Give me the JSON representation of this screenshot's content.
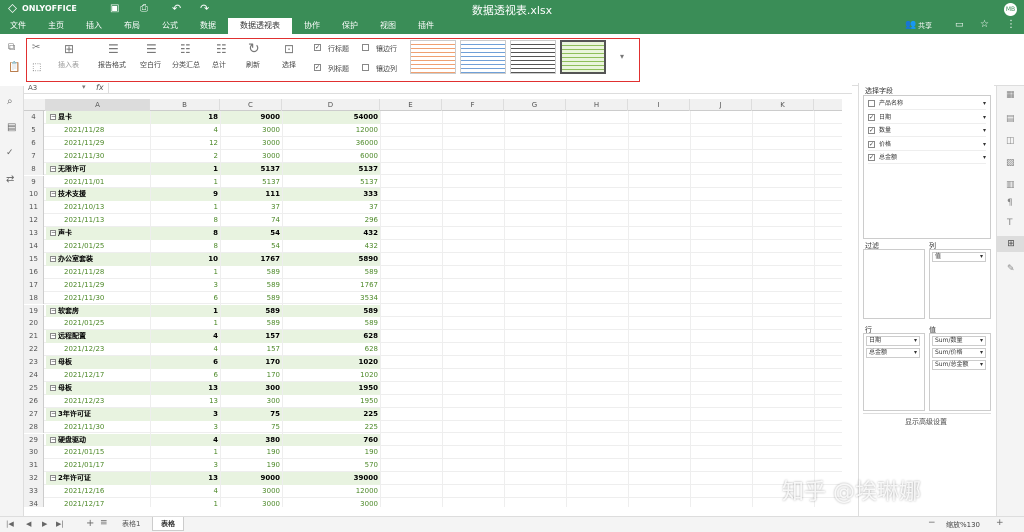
{
  "app": {
    "logo_text": "ONLYOFFICE",
    "title": "数据透视表.xlsx",
    "user_initials": "MB",
    "share_label": "共享"
  },
  "menu": [
    "文件",
    "主页",
    "插入",
    "布局",
    "公式",
    "数据",
    "数据透视表",
    "协作",
    "保护",
    "视图",
    "插件"
  ],
  "toolbar": {
    "insert_table": "插入表",
    "report_layout": "报告格式",
    "blank_rows": "空白行",
    "subtotals": "分类汇总",
    "grand_totals": "总计",
    "refresh": "刷新",
    "select": "选择",
    "row_headers": "行标题",
    "col_headers": "列标题",
    "banded_rows": "镶边行",
    "banded_cols": "镶边列"
  },
  "formula": {
    "cell_ref": "A3",
    "fx": "fx"
  },
  "columns": [
    "A",
    "B",
    "C",
    "D",
    "E",
    "F",
    "G",
    "H",
    "I",
    "J",
    "K",
    "L"
  ],
  "rows": [
    {
      "n": "4",
      "kind": "grp",
      "a": "显卡",
      "b": "18",
      "c": "9000",
      "d": "54000"
    },
    {
      "n": "5",
      "kind": "det",
      "a": "2021/11/28",
      "b": "4",
      "c": "3000",
      "d": "12000"
    },
    {
      "n": "6",
      "kind": "det",
      "a": "2021/11/29",
      "b": "12",
      "c": "3000",
      "d": "36000"
    },
    {
      "n": "7",
      "kind": "det",
      "a": "2021/11/30",
      "b": "2",
      "c": "3000",
      "d": "6000"
    },
    {
      "n": "8",
      "kind": "grp",
      "a": "无限许可",
      "b": "1",
      "c": "5137",
      "d": "5137"
    },
    {
      "n": "9",
      "kind": "det",
      "a": "2021/11/01",
      "b": "1",
      "c": "5137",
      "d": "5137"
    },
    {
      "n": "10",
      "kind": "grp",
      "a": "技术支援",
      "b": "9",
      "c": "111",
      "d": "333"
    },
    {
      "n": "11",
      "kind": "det",
      "a": "2021/10/13",
      "b": "1",
      "c": "37",
      "d": "37"
    },
    {
      "n": "12",
      "kind": "det",
      "a": "2021/11/13",
      "b": "8",
      "c": "74",
      "d": "296"
    },
    {
      "n": "13",
      "kind": "grp",
      "a": "声卡",
      "b": "8",
      "c": "54",
      "d": "432"
    },
    {
      "n": "14",
      "kind": "det",
      "a": "2021/01/25",
      "b": "8",
      "c": "54",
      "d": "432"
    },
    {
      "n": "15",
      "kind": "grp",
      "a": "办公室套装",
      "b": "10",
      "c": "1767",
      "d": "5890"
    },
    {
      "n": "16",
      "kind": "det",
      "a": "2021/11/28",
      "b": "1",
      "c": "589",
      "d": "589"
    },
    {
      "n": "17",
      "kind": "det",
      "a": "2021/11/29",
      "b": "3",
      "c": "589",
      "d": "1767"
    },
    {
      "n": "18",
      "kind": "det",
      "a": "2021/11/30",
      "b": "6",
      "c": "589",
      "d": "3534"
    },
    {
      "n": "19",
      "kind": "grp",
      "a": "软套房",
      "b": "1",
      "c": "589",
      "d": "589"
    },
    {
      "n": "20",
      "kind": "det",
      "a": "2021/01/25",
      "b": "1",
      "c": "589",
      "d": "589"
    },
    {
      "n": "21",
      "kind": "grp",
      "a": "远程配置",
      "b": "4",
      "c": "157",
      "d": "628"
    },
    {
      "n": "22",
      "kind": "det",
      "a": "2021/12/23",
      "b": "4",
      "c": "157",
      "d": "628"
    },
    {
      "n": "23",
      "kind": "grp",
      "a": "母板",
      "b": "6",
      "c": "170",
      "d": "1020"
    },
    {
      "n": "24",
      "kind": "det",
      "a": "2021/12/17",
      "b": "6",
      "c": "170",
      "d": "1020"
    },
    {
      "n": "25",
      "kind": "grp",
      "a": "母板",
      "b": "13",
      "c": "300",
      "d": "1950"
    },
    {
      "n": "26",
      "kind": "det",
      "a": "2021/12/23",
      "b": "13",
      "c": "300",
      "d": "1950"
    },
    {
      "n": "27",
      "kind": "grp",
      "a": "3年许可证",
      "b": "3",
      "c": "75",
      "d": "225"
    },
    {
      "n": "28",
      "kind": "det",
      "a": "2021/11/30",
      "b": "3",
      "c": "75",
      "d": "225"
    },
    {
      "n": "29",
      "kind": "grp",
      "a": "硬盘驱动",
      "b": "4",
      "c": "380",
      "d": "760"
    },
    {
      "n": "30",
      "kind": "det",
      "a": "2021/01/15",
      "b": "1",
      "c": "190",
      "d": "190"
    },
    {
      "n": "31",
      "kind": "det",
      "a": "2021/01/17",
      "b": "3",
      "c": "190",
      "d": "570"
    },
    {
      "n": "32",
      "kind": "grp",
      "a": "2年许可证",
      "b": "13",
      "c": "9000",
      "d": "39000"
    },
    {
      "n": "33",
      "kind": "det",
      "a": "2021/12/16",
      "b": "4",
      "c": "3000",
      "d": "12000"
    },
    {
      "n": "34",
      "kind": "det",
      "a": "2021/12/17",
      "b": "1",
      "c": "3000",
      "d": "3000"
    }
  ],
  "panel": {
    "choose_fields": "选择字段",
    "fields": [
      {
        "label": "产品名称",
        "checked": false
      },
      {
        "label": "日期",
        "checked": true
      },
      {
        "label": "数量",
        "checked": true
      },
      {
        "label": "价格",
        "checked": true
      },
      {
        "label": "总金额",
        "checked": true
      }
    ],
    "filters": "过滤",
    "columns": "列",
    "columns_items": [
      "值"
    ],
    "rows": "行",
    "rows_items": [
      "日期",
      "总金额"
    ],
    "values": "值",
    "values_items": [
      "Sum/数量",
      "Sum/价格",
      "Sum/总金额"
    ],
    "advanced": "显示高级设置"
  },
  "sheets": [
    "表格1",
    "表格"
  ],
  "zoom": "缩放%130",
  "watermark": "知乎 @埃琳娜"
}
